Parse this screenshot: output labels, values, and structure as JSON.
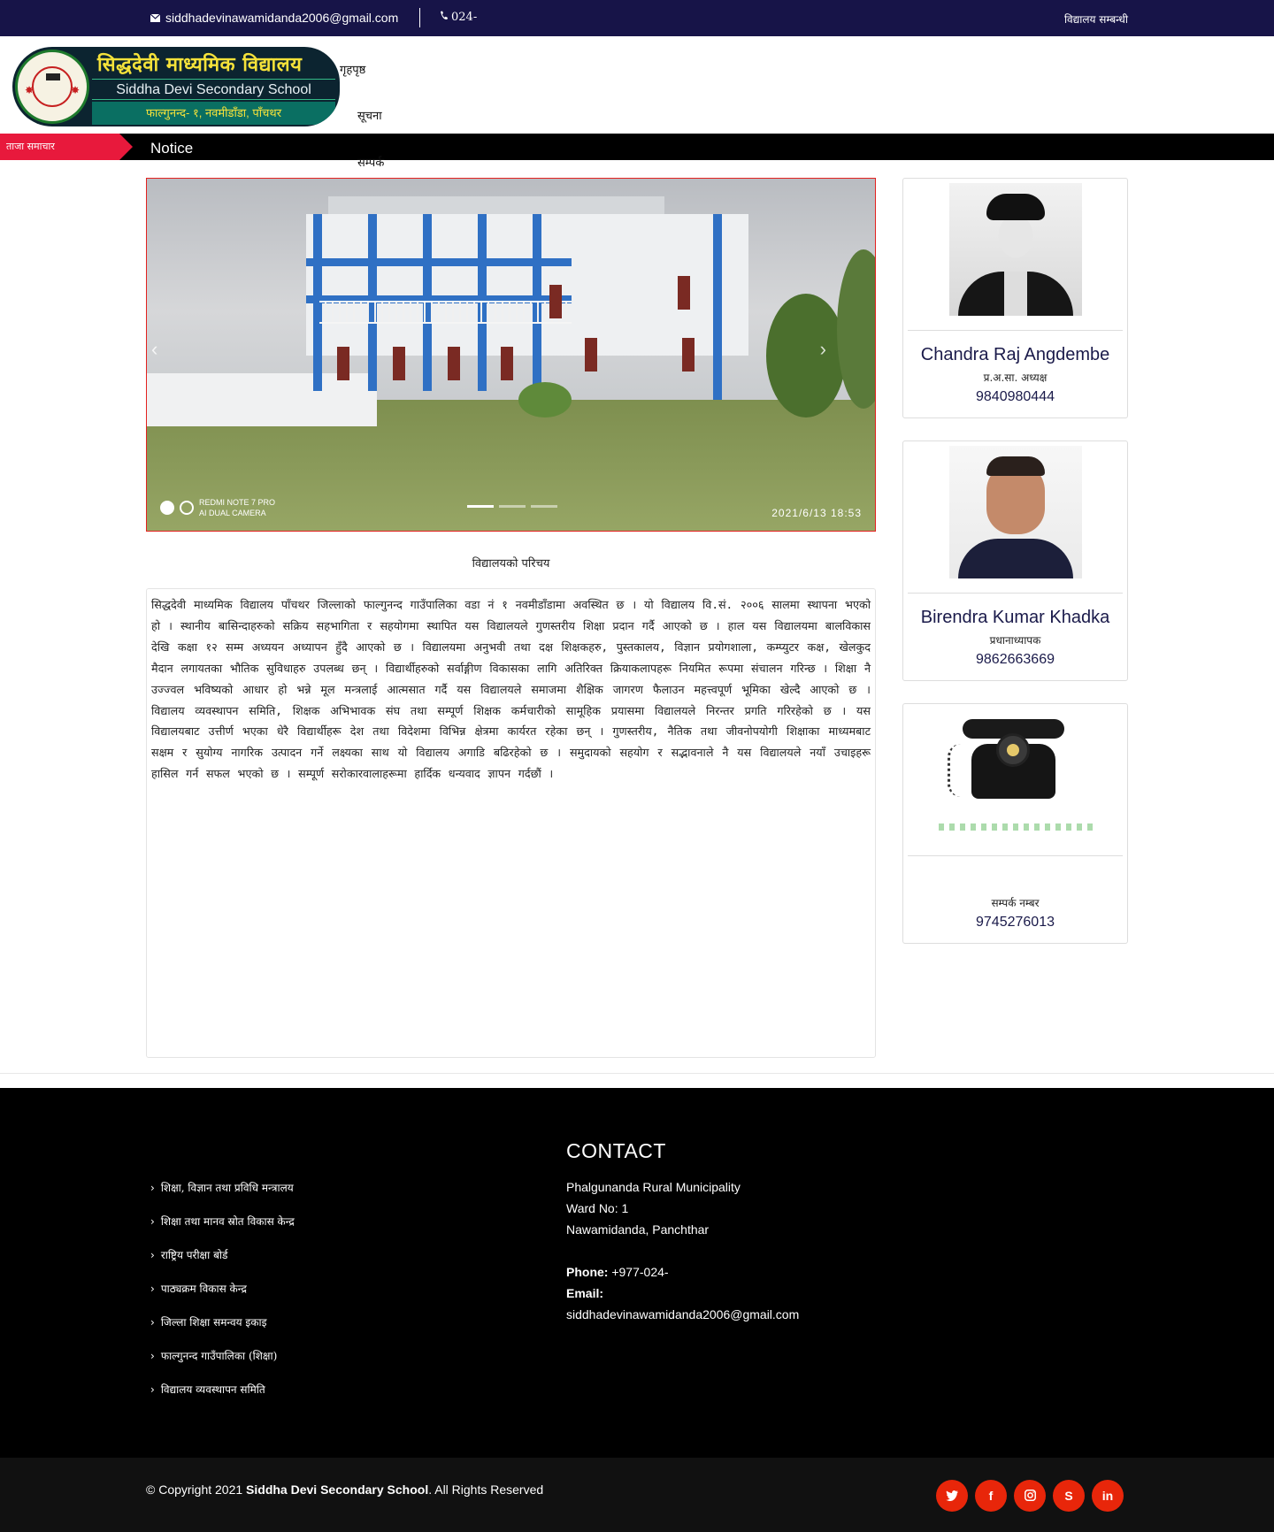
{
  "topbar": {
    "email": "siddhadevinawamidanda2006@gmail.com",
    "phone": "024-",
    "right_link": "विद्यालय सम्बन्धी"
  },
  "logo": {
    "title_np": "सिद्धदेवी माध्यमिक विद्यालय",
    "title_en": "Siddha Devi Secondary School",
    "address_np": "फाल्गुनन्द- १, नवमीडाँडा, पाँचथर",
    "seal_text": "स्था:२००६"
  },
  "nav": [
    "गृहपृष्ठ",
    "सूचना",
    "सम्पर्क"
  ],
  "ticker": {
    "label": "ताजा समाचार",
    "text": "Notice"
  },
  "slider": {
    "camera_line1": "REDMI NOTE 7 PRO",
    "camera_line2": "AI DUAL CAMERA",
    "timestamp": "2021/6/13 18:53",
    "slide_count": 3,
    "active_slide": 0
  },
  "intro": {
    "title": "विद्यालयको परिचय",
    "body": "सिद्धदेवी माध्यमिक विद्यालय पाँचथर जिल्लाको फाल्गुनन्द गाउँपालिका वडा नं १ नवमीडाँडामा अवस्थित छ । यो विद्यालय वि.सं. २००६ सालमा स्थापना भएको हो । स्थानीय बासिन्दाहरुको सक्रिय सहभागिता र सहयोगमा स्थापित यस विद्यालयले गुणस्तरीय शिक्षा प्रदान गर्दै आएको छ । हाल यस विद्यालयमा बालविकास देखि कक्षा १२ सम्म अध्ययन अध्यापन हुँदै आएको छ । विद्यालयमा अनुभवी तथा दक्ष शिक्षकहरु, पुस्तकालय, विज्ञान प्रयोगशाला, कम्प्युटर कक्ष, खेलकुद मैदान लगायतका भौतिक सुविधाहरु उपलब्ध छन् । विद्यार्थीहरुको सर्वाङ्गीण विकासका लागि अतिरिक्त क्रियाकलापहरू नियमित रूपमा संचालन गरिन्छ । शिक्षा नै उज्ज्वल भविष्यको आधार हो भन्ने मूल मन्त्रलाई आत्मसात गर्दै यस विद्यालयले समाजमा शैक्षिक जागरण फैलाउन महत्त्वपूर्ण भूमिका खेल्दै आएको छ । विद्यालय व्यवस्थापन समिति, शिक्षक अभिभावक संघ तथा सम्पूर्ण शिक्षक कर्मचारीको सामूहिक प्रयासमा विद्यालयले निरन्तर प्रगति गरिरहेको छ । यस विद्यालयबाट उत्तीर्ण भएका धेरै विद्यार्थीहरू देश तथा विदेशमा विभिन्न क्षेत्रमा कार्यरत रहेका छन् । गुणस्तरीय, नैतिक तथा जीवनोपयोगी शिक्षाका माध्यमबाट सक्षम र सुयोग्य नागरिक उत्पादन गर्ने लक्ष्यका साथ यो विद्यालय अगाडि बढिरहेको छ । समुदायको सहयोग र सद्भावनाले नै यस विद्यालयले नयाँ उचाइहरू हासिल गर्न सफल भएको छ । सम्पूर्ण सरोकारवालाहरूमा हार्दिक धन्यवाद ज्ञापन गर्दछौं ।"
  },
  "staff": [
    {
      "name": "Chandra Raj Angdembe",
      "role": "प्र.अ.सा. अध्यक्ष",
      "phone": "9840980444"
    },
    {
      "name": "Birendra Kumar Khadka",
      "role": "प्रधानाध्यापक",
      "phone": "9862663669"
    },
    {
      "name": "",
      "role": "सम्पर्क नम्बर",
      "phone": "9745276013"
    }
  ],
  "footer": {
    "links": [
      "शिक्षा, विज्ञान तथा प्रविधि मन्त्रालय",
      "शिक्षा तथा मानव स्रोत विकास केन्द्र",
      "राष्ट्रिय परीक्षा बोर्ड",
      "पाठ्यक्रम विकास केन्द्र",
      "जिल्ला शिक्षा समन्वय इकाइ",
      "फाल्गुनन्द गाउँपालिका (शिक्षा)",
      "विद्यालय व्यवस्थापन समिति"
    ],
    "contact_title": "CONTACT",
    "address1": "Phalgunanda Rural Municipality",
    "address2": "Ward No: 1",
    "address3": "Nawamidanda, Panchthar",
    "phone_label": "Phone:",
    "phone": "+977-024-",
    "email_label": "Email:",
    "email": "siddhadevinawamidanda2006@gmail.com"
  },
  "copyright": {
    "prefix": "© Copyright 2021 ",
    "name": "Siddha Devi Secondary School",
    "suffix": ". All Rights Reserved"
  },
  "social": [
    "twitter-icon",
    "facebook-icon",
    "instagram-icon",
    "skype-icon",
    "linkedin-icon"
  ],
  "colors": {
    "topbar": "#171448",
    "accent": "#e8193c",
    "social": "#e8260a"
  }
}
